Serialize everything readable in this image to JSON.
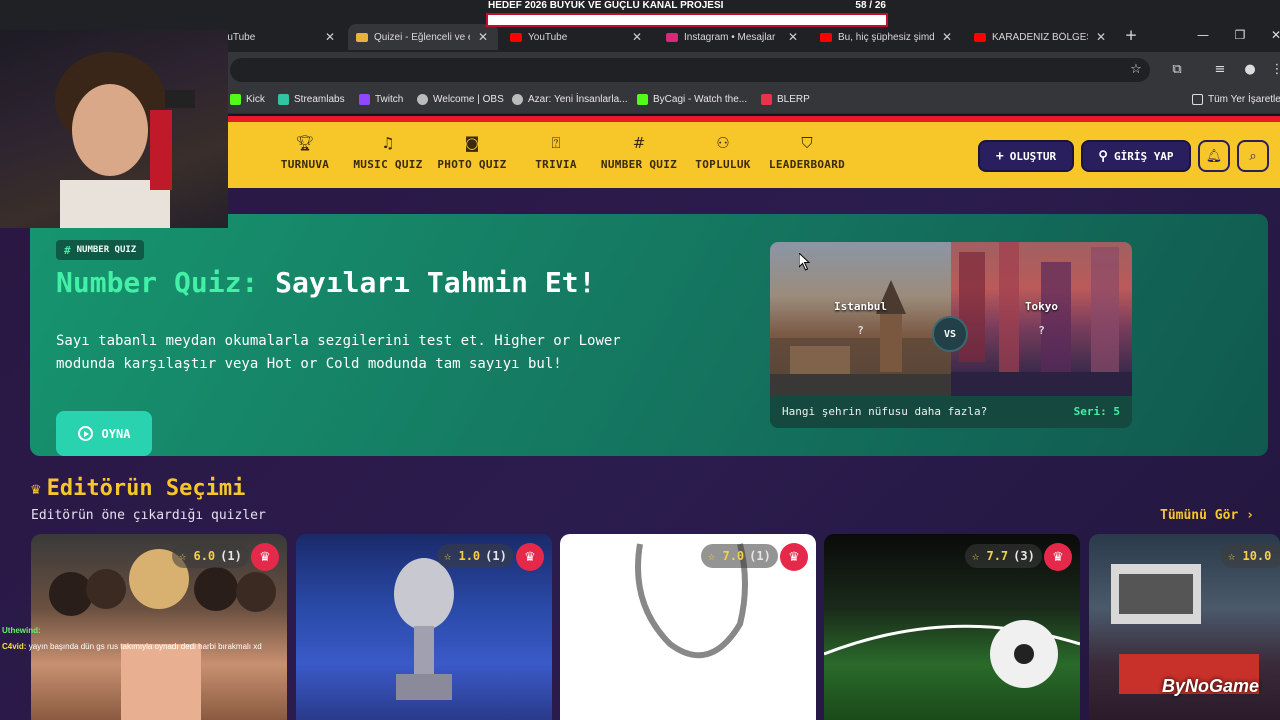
{
  "overlay": {
    "goal_title": "HEDEF 2026 BÜYÜK VE GÜÇLÜ KANAL PROJESI",
    "goal_count": "58  / 26",
    "goal_progress": 0.0
  },
  "browser": {
    "tabs": [
      {
        "label": "YouTube",
        "icon_color": "#ff0000",
        "active": false
      },
      {
        "label": "Quizei - Eğlenceli ve eğ",
        "icon_color": "#e8b339",
        "active": true
      },
      {
        "label": "YouTube",
        "icon_color": "#ff0000",
        "active": false
      },
      {
        "label": "Instagram • Mesajlar",
        "icon_color": "#d62976",
        "active": false
      },
      {
        "label": "Bu, hiç şüphesiz şimdiy",
        "icon_color": "#ff0000",
        "active": false
      },
      {
        "label": "KARADENİZ BÖLGESİ'",
        "icon_color": "#ff0000",
        "active": false
      }
    ],
    "new_tab_icon": "plus-icon",
    "bookmarks": [
      {
        "label": "Kick",
        "icon_color": "#53fc18"
      },
      {
        "label": "Streamlabs",
        "icon_color": "#31c3a2"
      },
      {
        "label": "Twitch",
        "icon_color": "#9146ff"
      },
      {
        "label": "Welcome | OBS",
        "icon_color": "#bbbbbb"
      },
      {
        "label": "Azar: Yeni İnsanlarla...",
        "icon_color": "#bbbbbb"
      },
      {
        "label": "ByCagi - Watch the...",
        "icon_color": "#53fc18"
      },
      {
        "label": "BLERP",
        "icon_color": "#e8334a"
      }
    ],
    "all_bookmarks_label": "Tüm Yer İşaretle"
  },
  "nav": {
    "items": [
      {
        "label": "TURNUVA",
        "icon": "trophy-icon"
      },
      {
        "label": "MUSIC QUIZ",
        "icon": "music-icon"
      },
      {
        "label": "PHOTO QUIZ",
        "icon": "camera-icon"
      },
      {
        "label": "TRIVIA",
        "icon": "question-icon"
      },
      {
        "label": "NUMBER QUIZ",
        "icon": "hash-icon"
      },
      {
        "label": "TOPLULUK",
        "icon": "users-icon"
      },
      {
        "label": "LEADERBOARD",
        "icon": "badge-icon"
      }
    ],
    "create_label": "OLUŞTUR",
    "login_label": "GİRİŞ YAP"
  },
  "hero": {
    "tag": "NUMBER QUIZ",
    "title_accent": "Number Quiz:",
    "title_rest": "Sayıları Tahmin Et!",
    "description": "Sayı tabanlı meydan okumalarla sezgilerini test et. Higher or Lower modunda karşılaştır veya Hot or Cold modunda tam sayıyı bul!",
    "play_label": "OYNA",
    "compare": {
      "left_city": "Istanbul",
      "right_city": "Tokyo",
      "unknown": "?",
      "vs": "VS",
      "question": "Hangi şehrin nüfusu daha fazla?",
      "streak": "Seri: 5"
    }
  },
  "editors_pick": {
    "title": "Editörün Seçimi",
    "subtitle": "Editörün öne çıkardığı quizler",
    "see_all": "Tümünü Gör ›",
    "cards": [
      {
        "rating": "6.0",
        "count": "(1)"
      },
      {
        "rating": "1.0",
        "count": "(1)"
      },
      {
        "rating": "7.0",
        "count": "(1)"
      },
      {
        "rating": "7.7",
        "count": "(3)"
      },
      {
        "rating": "10.0",
        "count": ""
      }
    ]
  },
  "chat": [
    {
      "user": "Uthewind:",
      "message": ""
    },
    {
      "user": "C4vid:",
      "message": "yayın başında dün gs rus takımıyla oynadı dedi harbi bırakmalı xd"
    }
  ],
  "watermark": "ByNoGame",
  "colors": {
    "site_yellow": "#f7c72a",
    "hero_green": "#16956f",
    "accent_green": "#42f0a6",
    "button_navy": "#2a1f5e"
  }
}
